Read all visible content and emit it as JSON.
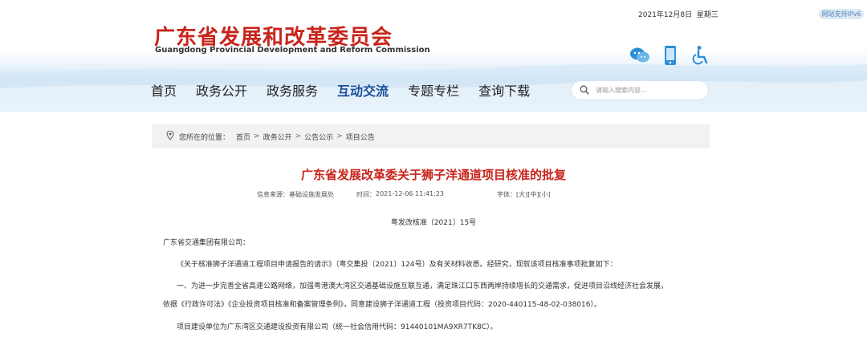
{
  "header": {
    "date": "2021年12月8日",
    "weekday": "星期三",
    "ipv6_badge": "网站支持IPv6",
    "logo_cn": "广东省发展和改革委员会",
    "logo_en": "Guangdong Provincial Development and Reform Commission",
    "icons": [
      "wechat-icon",
      "mobile-icon",
      "accessibility-icon"
    ]
  },
  "nav": {
    "items": [
      "首页",
      "政务公开",
      "政务服务",
      "互动交流",
      "专题专栏",
      "查询下载"
    ],
    "active_index": 3
  },
  "search": {
    "placeholder": "请输入搜索内容..."
  },
  "breadcrumb": {
    "label": "您所在的位置：",
    "items": [
      "首页",
      "政务公开",
      "公告公示",
      "项目公告"
    ]
  },
  "article": {
    "title": "广东省发展改革委关于狮子洋通道项目核准的批复",
    "source_label": "信息来源：",
    "source": "基础设施发展处",
    "time_label": "时间：",
    "time": "2021-12-06 11:41:23",
    "fontsize_label": "字体：",
    "fontsize_options": [
      "[大]",
      "[中]",
      "[小]"
    ],
    "doc_no": "粤发改核准〔2021〕15号",
    "paragraphs": [
      "广东省交通集团有限公司：",
      "《关于核准狮子洋通道工程项目申请报告的请示》（粤交集投〔2021〕124号）及有关材料收悉。经研究，现就该项目核准事项批复如下：",
      "一、为进一步完善全省高速公路网络，加强粤港澳大湾区交通基础设施互联互通，满足珠江口东西两岸持续增长的交通需求，促进项目沿线经济社会发展，",
      "依据《行政许可法》《企业投资项目核准和备案管理条例》，同意建设狮子洋通道工程（投资项目代码：2020-440115-48-02-038016）。",
      "项目建设单位为广东湾区交通建设投资有限公司（统一社会信用代码：91440101MA9XR7TK8C）。"
    ]
  },
  "colors": {
    "brand_red": "#c8241b",
    "nav_active": "#1b4f9c"
  }
}
